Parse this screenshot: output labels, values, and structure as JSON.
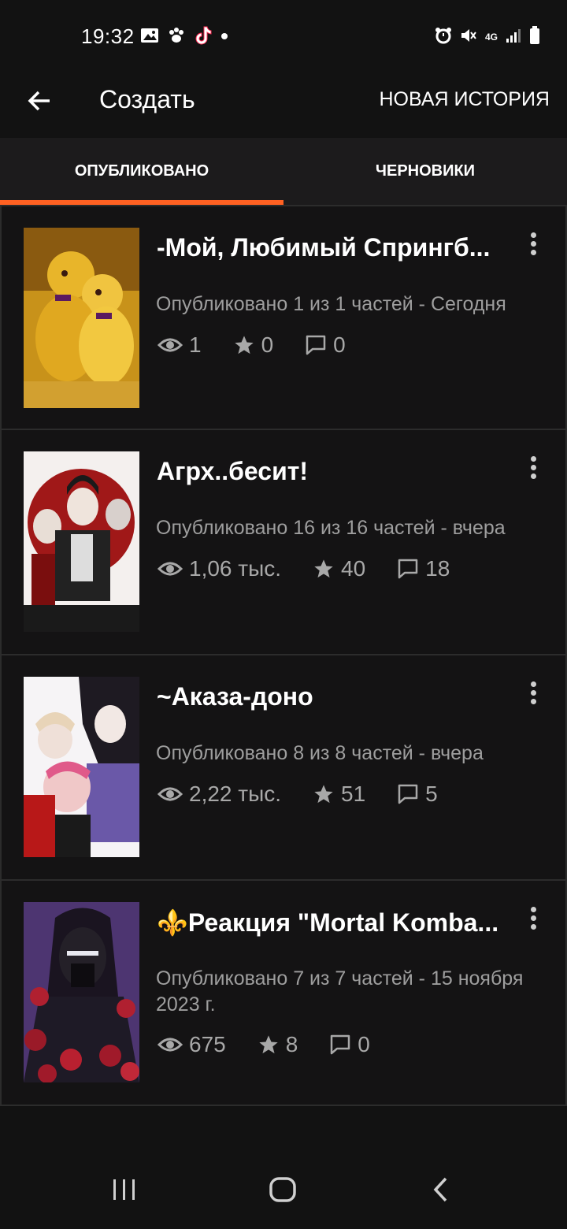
{
  "status_bar": {
    "time": "19:32",
    "left_icons": [
      "image-icon",
      "paw-icon",
      "tiktok-icon",
      "dot-icon"
    ],
    "right_icons": [
      "alarm-icon",
      "mute-icon",
      "4g-icon",
      "signal-icon",
      "battery-icon"
    ],
    "network_label": "4G"
  },
  "app_bar": {
    "title": "Создать",
    "action_label": "НОВАЯ ИСТОРИЯ"
  },
  "tabs": [
    {
      "label": "ОПУБЛИКОВАНО",
      "active": true
    },
    {
      "label": "ЧЕРНОВИКИ",
      "active": false
    }
  ],
  "colors": {
    "accent": "#ff6122",
    "background": "#121212",
    "card": "#141314",
    "muted_text": "#9e9e9e"
  },
  "stories": [
    {
      "title": "-Мой, Любимый Спрингб...",
      "meta": "Опубликовано 1 из 1 частей - Сегодня",
      "views": "1",
      "votes": "0",
      "comments": "0",
      "cover_theme": "yellow"
    },
    {
      "title": "Агрх..бесит!",
      "meta": "Опубликовано 16 из 16 частей - вчера",
      "views": "1,06 тыс.",
      "votes": "40",
      "comments": "18",
      "cover_theme": "red-circle"
    },
    {
      "title": "~Аказа-доно",
      "meta": "Опубликовано 8 из 8 частей - вчера",
      "views": "2,22 тыс.",
      "votes": "51",
      "comments": "5",
      "cover_theme": "purple-red"
    },
    {
      "title": "⚜️Реакция \"Mortal Komba...",
      "meta": "Опубликовано 7 из 7 частей - 15 ноября 2023 г.",
      "views": "675",
      "votes": "8",
      "comments": "0",
      "cover_theme": "dark-purple"
    }
  ],
  "nav_bar": {
    "buttons": [
      "recents-icon",
      "home-icon",
      "back-icon"
    ]
  }
}
